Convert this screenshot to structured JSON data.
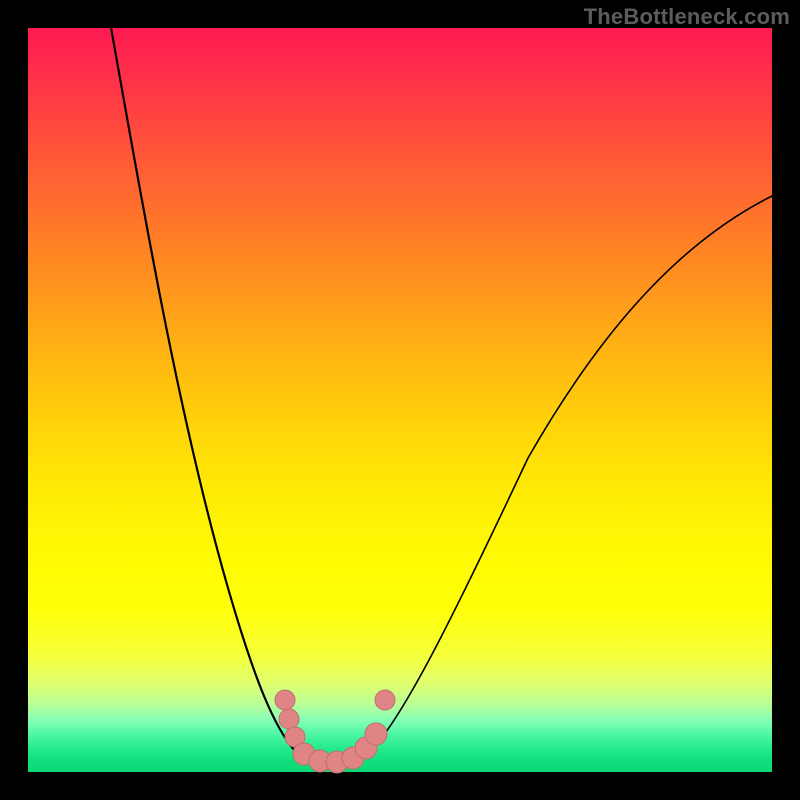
{
  "watermark": "TheBottleneck.com",
  "chart_data": {
    "type": "line",
    "title": "",
    "xlabel": "",
    "ylabel": "",
    "xlim": [
      0,
      100
    ],
    "ylim": [
      0,
      100
    ],
    "grid": false,
    "legend": false,
    "background_gradient": {
      "direction": "vertical",
      "stops": [
        {
          "pct": 0,
          "color": "#ff1a52",
          "meaning": "high-bottleneck"
        },
        {
          "pct": 50,
          "color": "#ffd509",
          "meaning": "moderate"
        },
        {
          "pct": 78,
          "color": "#ffff08",
          "meaning": "low"
        },
        {
          "pct": 100,
          "color": "#0cd776",
          "meaning": "no-bottleneck"
        }
      ]
    },
    "series": [
      {
        "name": "bottleneck-curve",
        "color": "#000000",
        "x": [
          11,
          15,
          20,
          27,
          34,
          36,
          37,
          39,
          41,
          45,
          47,
          55,
          67,
          80,
          100
        ],
        "y": [
          100,
          80,
          55,
          25,
          6,
          3,
          2,
          1,
          2,
          3,
          6,
          20,
          42,
          63,
          77
        ]
      }
    ],
    "sample_points": {
      "name": "highlighted-range",
      "color": "#e08585",
      "x": [
        34.5,
        35.1,
        35.9,
        37.1,
        39.2,
        41.5,
        43.7,
        45.4,
        46.8,
        48.0
      ],
      "y": [
        9.7,
        7.1,
        4.7,
        2.4,
        1.5,
        1.3,
        1.9,
        3.2,
        5.1,
        9.7
      ]
    },
    "annotations": [
      {
        "text": "TheBottleneck.com",
        "position": "top-right",
        "role": "watermark"
      }
    ]
  }
}
